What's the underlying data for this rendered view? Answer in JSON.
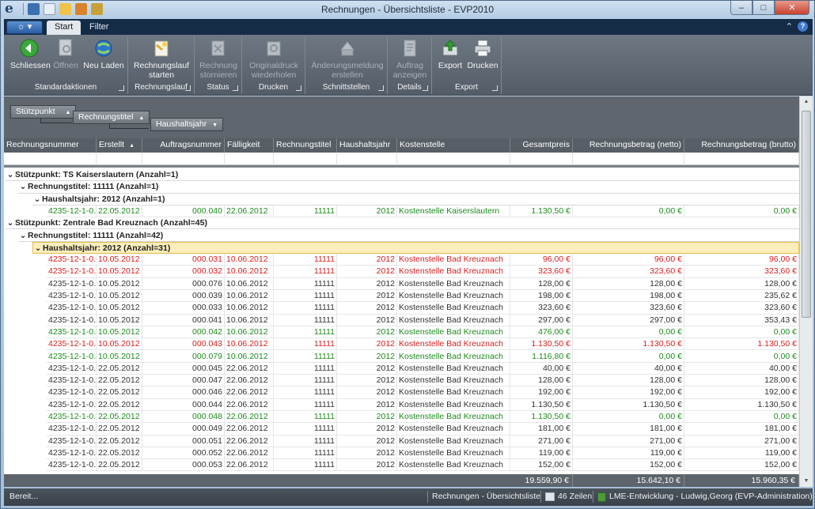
{
  "window": {
    "title": "Rechnungen - Übersichtsliste - EVP2010",
    "controls": {
      "minimize": "–",
      "maximize": "□",
      "close": "✕"
    }
  },
  "ribbon": {
    "tabs": [
      {
        "label": "Start",
        "active": true
      },
      {
        "label": "Filter",
        "active": false
      }
    ],
    "groups": [
      {
        "label": "Standardaktionen",
        "buttons": [
          {
            "label": "Schliessen",
            "icon": "back-arrow-icon"
          },
          {
            "label": "Öffnen",
            "icon": "open-document-icon",
            "disabled": true
          },
          {
            "label": "Neu Laden",
            "icon": "refresh-globe-icon"
          }
        ]
      },
      {
        "label": "Rechnungslauf",
        "buttons": [
          {
            "label": "Rechnungslauf starten",
            "icon": "invoice-run-icon"
          }
        ]
      },
      {
        "label": "Status",
        "buttons": [
          {
            "label": "Rechnung stornieren",
            "icon": "cancel-invoice-icon",
            "disabled": true
          }
        ]
      },
      {
        "label": "Drucken",
        "buttons": [
          {
            "label": "Originaldruck wiederholen",
            "icon": "reprint-icon",
            "disabled": true
          }
        ]
      },
      {
        "label": "Schnittstellen",
        "buttons": [
          {
            "label": "Änderungsmeldung erstellen",
            "icon": "change-notice-icon",
            "disabled": true
          }
        ]
      },
      {
        "label": "Details",
        "buttons": [
          {
            "label": "Auftrag anzeigen",
            "icon": "order-details-icon",
            "disabled": true
          }
        ]
      },
      {
        "label": "Export",
        "buttons": [
          {
            "label": "Export",
            "icon": "export-icon"
          },
          {
            "label": "Drucken",
            "icon": "printer-icon"
          }
        ]
      }
    ]
  },
  "groupby": {
    "chips": [
      {
        "label": "Stützpunkt",
        "sort": "▲"
      },
      {
        "label": "Rechnungstitel",
        "sort": "▲"
      },
      {
        "label": "Haushaltsjahr",
        "sort": "▼"
      }
    ]
  },
  "grid": {
    "columns": [
      {
        "label": "Rechnungsnummer"
      },
      {
        "label": "Erstellt",
        "sort": "▲"
      },
      {
        "label": "Auftragsnummer"
      },
      {
        "label": "Fälligkeit"
      },
      {
        "label": "Rechnungstitel",
        "sort": "▲"
      },
      {
        "label": "Haushaltsjahr",
        "sort": "▼"
      },
      {
        "label": "Kostenstelle"
      },
      {
        "label": "Gesamtpreis"
      },
      {
        "label": "Rechnungsbetrag (netto)"
      },
      {
        "label": "Rechnungsbetrag (brutto)"
      }
    ],
    "groups": [
      {
        "level": 0,
        "label": "Stützpunkt: TS Kaiserslautern (Anzahl=1)"
      },
      {
        "level": 1,
        "label": "Rechnungstitel: 11111 (Anzahl=1)"
      },
      {
        "level": 2,
        "label": "Haushaltsjahr: 2012 (Anzahl=1)"
      },
      {
        "level": 0,
        "label": "Stützpunkt: Zentrale Bad Kreuznach (Anzahl=45)"
      },
      {
        "level": 1,
        "label": "Rechnungstitel: 11111 (Anzahl=42)"
      },
      {
        "level": 2,
        "label": "Haushaltsjahr: 2012 (Anzahl=31)",
        "selected": true
      }
    ],
    "rows": [
      {
        "color": "green",
        "cells": [
          "4235-12-1-0...",
          "22.05.2012",
          "000.040",
          "22.06.2012",
          "11111",
          "2012",
          "Kostenstelle Kaiserslautern",
          "1.130,50 €",
          "0,00 €",
          "0,00 €"
        ]
      },
      {
        "color": "red",
        "cells": [
          "4235-12-1-0...",
          "10.05.2012",
          "000.031",
          "10.06.2012",
          "11111",
          "2012",
          "Kostenstelle Bad Kreuznach",
          "96,00 €",
          "96,00 €",
          "96,00 €"
        ]
      },
      {
        "color": "red",
        "cells": [
          "4235-12-1-0...",
          "10.05.2012",
          "000.032",
          "10.06.2012",
          "11111",
          "2012",
          "Kostenstelle Bad Kreuznach",
          "323,60 €",
          "323,60 €",
          "323,60 €"
        ]
      },
      {
        "color": "black",
        "cells": [
          "4235-12-1-0...",
          "10.05.2012",
          "000.076",
          "10.06.2012",
          "11111",
          "2012",
          "Kostenstelle Bad Kreuznach",
          "128,00 €",
          "128,00 €",
          "128,00 €"
        ]
      },
      {
        "color": "black",
        "cells": [
          "4235-12-1-0...",
          "10.05.2012",
          "000.039",
          "10.06.2012",
          "11111",
          "2012",
          "Kostenstelle Bad Kreuznach",
          "198,00 €",
          "198,00 €",
          "235,62 €"
        ]
      },
      {
        "color": "black",
        "cells": [
          "4235-12-1-0...",
          "10.05.2012",
          "000.033",
          "10.06.2012",
          "11111",
          "2012",
          "Kostenstelle Bad Kreuznach",
          "323,60 €",
          "323,60 €",
          "323,60 €"
        ]
      },
      {
        "color": "black",
        "cells": [
          "4235-12-1-0...",
          "10.05.2012",
          "000.041",
          "10.06.2012",
          "11111",
          "2012",
          "Kostenstelle Bad Kreuznach",
          "297,00 €",
          "297,00 €",
          "353,43 €"
        ]
      },
      {
        "color": "green",
        "cells": [
          "4235-12-1-0...",
          "10.05.2012",
          "000.042",
          "10.06.2012",
          "11111",
          "2012",
          "Kostenstelle Bad Kreuznach",
          "476,00 €",
          "0,00 €",
          "0,00 €"
        ]
      },
      {
        "color": "red",
        "cells": [
          "4235-12-1-0...",
          "10.05.2012",
          "000.043",
          "10.06.2012",
          "11111",
          "2012",
          "Kostenstelle Bad Kreuznach",
          "1.130,50 €",
          "1.130,50 €",
          "1.130,50 €"
        ]
      },
      {
        "color": "green",
        "cells": [
          "4235-12-1-0...",
          "10.05.2012",
          "000.079",
          "10.06.2012",
          "11111",
          "2012",
          "Kostenstelle Bad Kreuznach",
          "1.116,80 €",
          "0,00 €",
          "0,00 €"
        ]
      },
      {
        "color": "black",
        "cells": [
          "4235-12-1-0...",
          "22.05.2012",
          "000.045",
          "22.06.2012",
          "11111",
          "2012",
          "Kostenstelle Bad Kreuznach",
          "40,00 €",
          "40,00 €",
          "40,00 €"
        ]
      },
      {
        "color": "black",
        "cells": [
          "4235-12-1-0...",
          "22.05.2012",
          "000.047",
          "22.06.2012",
          "11111",
          "2012",
          "Kostenstelle Bad Kreuznach",
          "128,00 €",
          "128,00 €",
          "128,00 €"
        ]
      },
      {
        "color": "black",
        "cells": [
          "4235-12-1-0...",
          "22.05.2012",
          "000.046",
          "22.06.2012",
          "11111",
          "2012",
          "Kostenstelle Bad Kreuznach",
          "192,00 €",
          "192,00 €",
          "192,00 €"
        ]
      },
      {
        "color": "black",
        "cells": [
          "4235-12-1-0...",
          "22.05.2012",
          "000.044",
          "22.06.2012",
          "11111",
          "2012",
          "Kostenstelle Bad Kreuznach",
          "1.130,50 €",
          "1.130,50 €",
          "1.130,50 €"
        ]
      },
      {
        "color": "green",
        "cells": [
          "4235-12-1-0...",
          "22.05.2012",
          "000.048",
          "22.06.2012",
          "11111",
          "2012",
          "Kostenstelle Bad Kreuznach",
          "1.130,50 €",
          "0,00 €",
          "0,00 €"
        ]
      },
      {
        "color": "black",
        "cells": [
          "4235-12-1-0...",
          "22.05.2012",
          "000.049",
          "22.06.2012",
          "11111",
          "2012",
          "Kostenstelle Bad Kreuznach",
          "181,00 €",
          "181,00 €",
          "181,00 €"
        ]
      },
      {
        "color": "black",
        "cells": [
          "4235-12-1-0...",
          "22.05.2012",
          "000.051",
          "22.06.2012",
          "11111",
          "2012",
          "Kostenstelle Bad Kreuznach",
          "271,00 €",
          "271,00 €",
          "271,00 €"
        ]
      },
      {
        "color": "black",
        "cells": [
          "4235-12-1-0...",
          "22.05.2012",
          "000.052",
          "22.06.2012",
          "11111",
          "2012",
          "Kostenstelle Bad Kreuznach",
          "119,00 €",
          "119,00 €",
          "119,00 €"
        ]
      },
      {
        "color": "black",
        "cells": [
          "4235-12-1-0...",
          "22.05.2012",
          "000.053",
          "22.06.2012",
          "11111",
          "2012",
          "Kostenstelle Bad Kreuznach",
          "152,00 €",
          "152,00 €",
          "152,00 €"
        ]
      }
    ],
    "totals": {
      "gesamtpreis": "19.559,90 €",
      "netto": "15.642,10 €",
      "brutto": "15.960,35 €"
    }
  },
  "status": {
    "ready": "Bereit...",
    "view": "Rechnungen - Übersichtsliste",
    "row_count": "46 Zeilen",
    "connection": "LME-Entwicklung - Ludwig,Georg (EVP-Administration)"
  },
  "colors": {
    "green": "#1c8c1c",
    "red": "#d81e1e",
    "selection": "#fbeebb"
  }
}
